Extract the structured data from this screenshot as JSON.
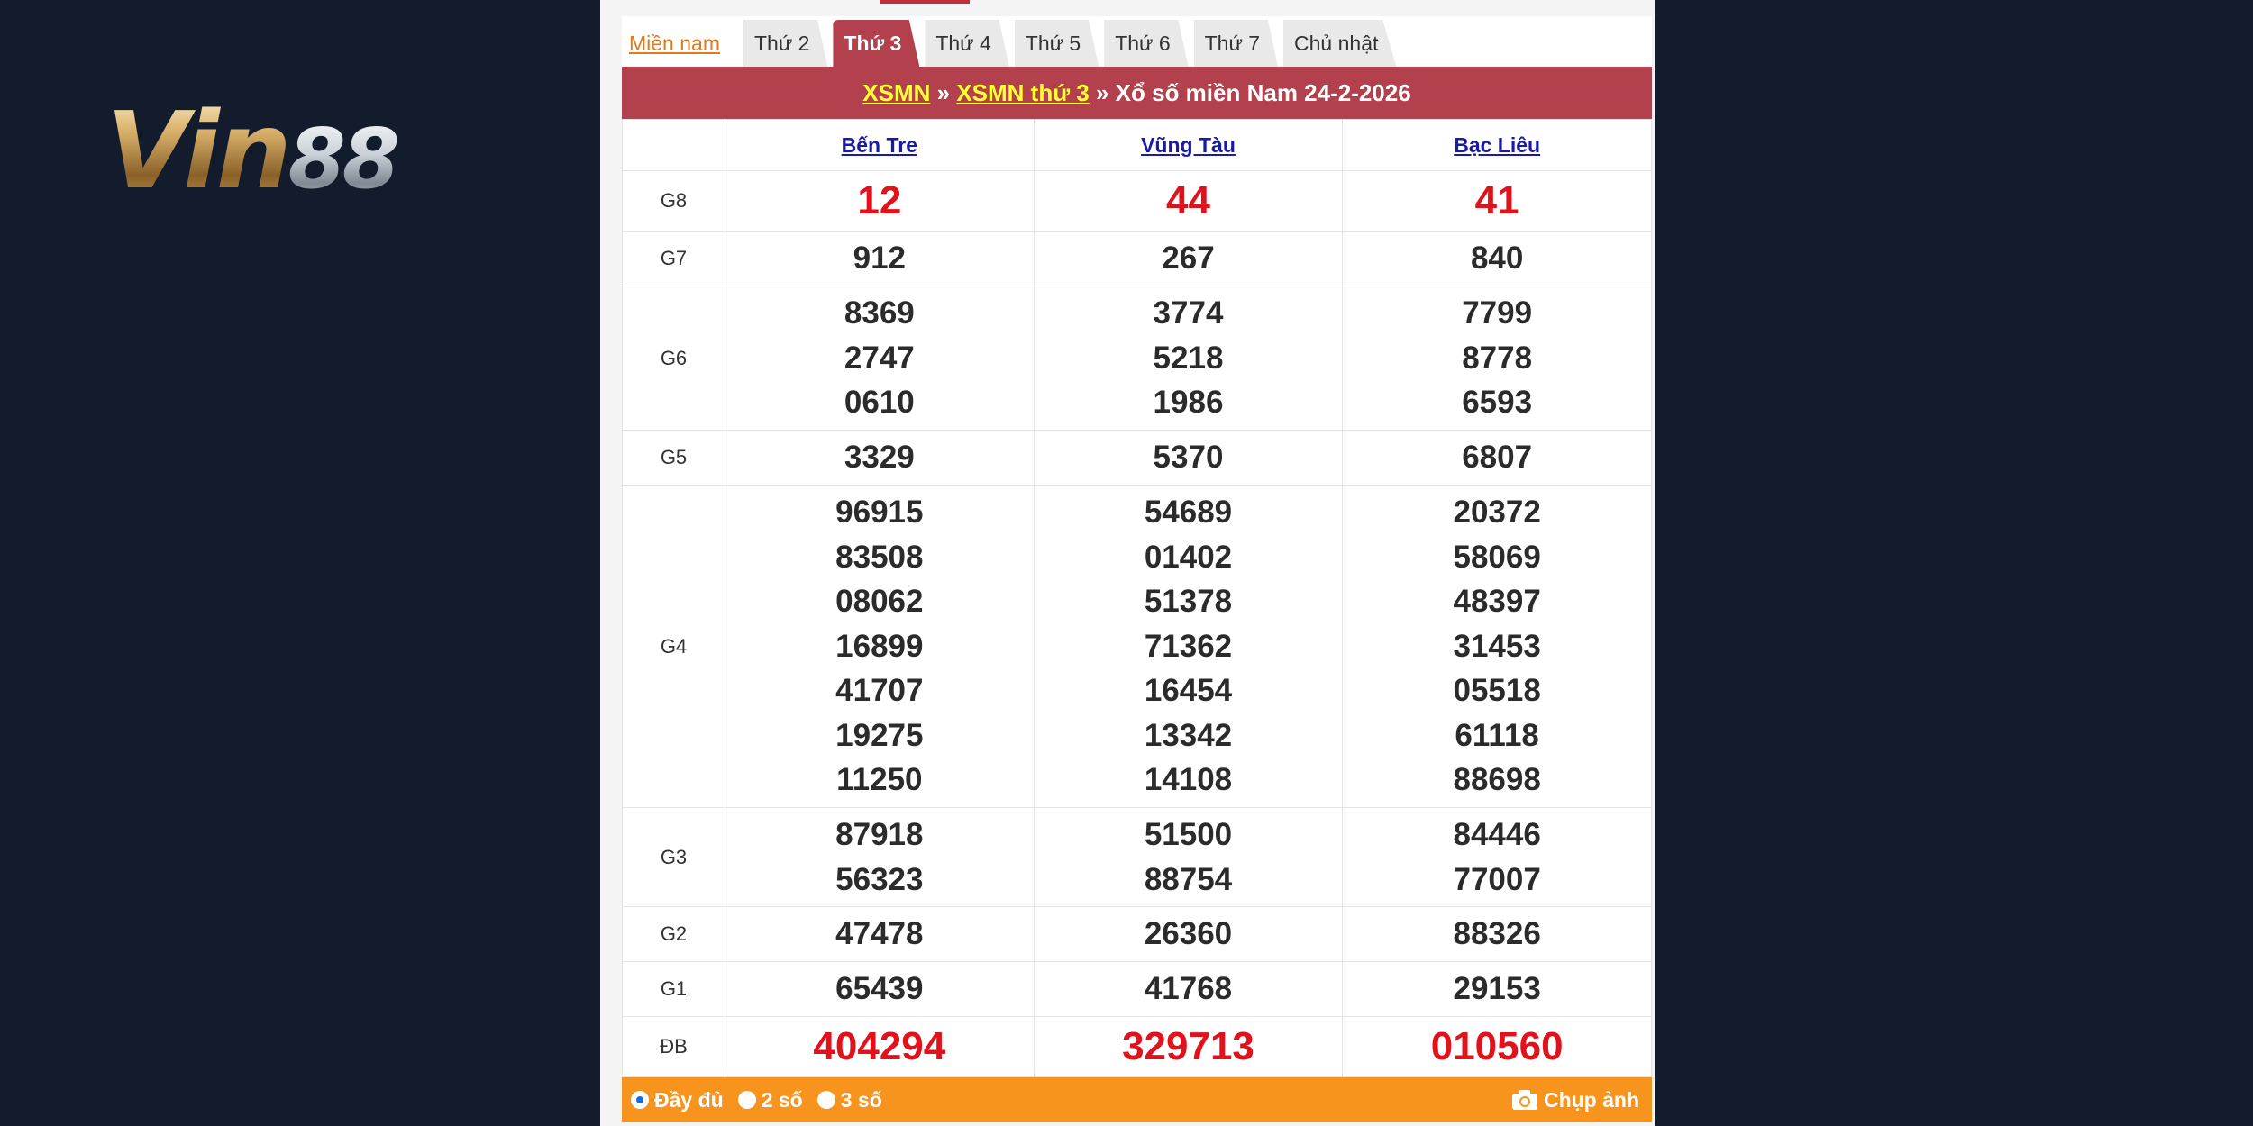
{
  "logo": {
    "v": "Vin",
    "n": "88"
  },
  "tabs": [
    "Miền nam",
    "Thứ 2",
    "Thứ 3",
    "Thứ 4",
    "Thứ 5",
    "Thứ 6",
    "Thứ 7",
    "Chủ nhật"
  ],
  "title": {
    "link1": "XSMN",
    "sep1": " » ",
    "link2": "XSMN thứ 3",
    "rest": " » Xổ số miền Nam 24-2-2026"
  },
  "provinces": [
    "Bến Tre",
    "Vũng Tàu",
    "Bạc Liêu"
  ],
  "prizes": {
    "g8": {
      "label": "G8",
      "vals": [
        "12",
        "44",
        "41"
      ]
    },
    "g7": {
      "label": "G7",
      "vals": [
        "912",
        "267",
        "840"
      ]
    },
    "g6": {
      "label": "G6",
      "vals": [
        [
          "8369",
          "2747",
          "0610"
        ],
        [
          "3774",
          "5218",
          "1986"
        ],
        [
          "7799",
          "8778",
          "6593"
        ]
      ]
    },
    "g5": {
      "label": "G5",
      "vals": [
        "3329",
        "5370",
        "6807"
      ]
    },
    "g4": {
      "label": "G4",
      "vals": [
        [
          "96915",
          "83508",
          "08062",
          "16899",
          "41707",
          "19275",
          "11250"
        ],
        [
          "54689",
          "01402",
          "51378",
          "71362",
          "16454",
          "13342",
          "14108"
        ],
        [
          "20372",
          "58069",
          "48397",
          "31453",
          "05518",
          "61118",
          "88698"
        ]
      ]
    },
    "g3": {
      "label": "G3",
      "vals": [
        [
          "87918",
          "56323"
        ],
        [
          "51500",
          "88754"
        ],
        [
          "84446",
          "77007"
        ]
      ]
    },
    "g2": {
      "label": "G2",
      "vals": [
        "47478",
        "26360",
        "88326"
      ]
    },
    "g1": {
      "label": "G1",
      "vals": [
        "65439",
        "41768",
        "29153"
      ]
    },
    "db": {
      "label": "ĐB",
      "vals": [
        "404294",
        "329713",
        "010560"
      ]
    }
  },
  "footer": {
    "opt1": "Đầy đủ",
    "opt2": "2 số",
    "opt3": "3 số",
    "capture": "Chụp ảnh"
  },
  "colors": {
    "accent": "#b3414d",
    "footer": "#f7941e",
    "red": "#e0131c"
  }
}
